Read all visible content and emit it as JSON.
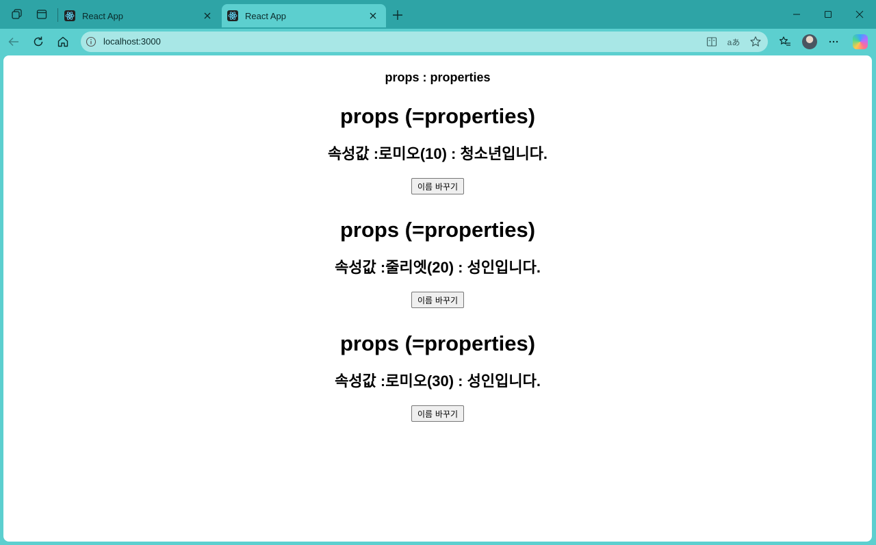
{
  "browser": {
    "tabs": [
      {
        "title": "React App",
        "active": false
      },
      {
        "title": "React App",
        "active": true
      }
    ],
    "url": "localhost:3000"
  },
  "page": {
    "heading": "props : properties",
    "blocks": [
      {
        "title": "props (=properties)",
        "subtitle": "속성값 :로미오(10) : 청소년입니다.",
        "button": "이름 바꾸기"
      },
      {
        "title": "props (=properties)",
        "subtitle": "속성값 :줄리엣(20) : 성인입니다.",
        "button": "이름 바꾸기"
      },
      {
        "title": "props (=properties)",
        "subtitle": "속성값 :로미오(30) : 성인입니다.",
        "button": "이름 바꾸기"
      }
    ]
  },
  "colors": {
    "frame": "#2ea4a6",
    "toolbar": "#5ccfcf",
    "omnibox": "#a8e7e6"
  },
  "icons": [
    "workspaces-icon",
    "tab-actions-icon",
    "react-icon",
    "close-icon",
    "plus-icon",
    "minimize-icon",
    "maximize-icon",
    "back-icon",
    "refresh-icon",
    "home-icon",
    "info-icon",
    "immersive-reader-icon",
    "read-aloud-icon",
    "favorite-star-icon",
    "favorites-icon",
    "more-icon",
    "copilot-icon"
  ]
}
